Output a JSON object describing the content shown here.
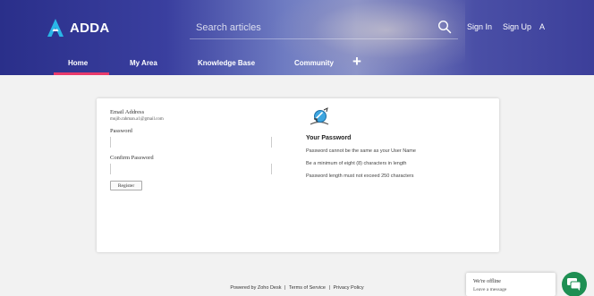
{
  "header": {
    "brand": "ADDA",
    "search_placeholder": "Search articles",
    "sign_in": "Sign In",
    "sign_up": "Sign Up",
    "lang": "A"
  },
  "nav": {
    "items": [
      {
        "label": "Home",
        "active": true
      },
      {
        "label": "My Area"
      },
      {
        "label": "Knowledge Base"
      },
      {
        "label": "Community"
      }
    ],
    "plus": "+",
    "accent_color": "#e83a6b"
  },
  "form": {
    "email_label": "Email Address",
    "email_value": "mujib.rahman.a1@gmail.com",
    "password_label": "Password",
    "confirm_label": "Confirm Password",
    "register_label": "Register"
  },
  "info": {
    "title": "Your Password",
    "rules": [
      "Password cannot be the same as your User Name",
      "Be a minimum of eight (8) characters in length",
      "Password length must not exceed 250 characters"
    ]
  },
  "footer": {
    "powered": "Powered by Zoho Desk",
    "sep1": "|",
    "terms": "Terms of Service",
    "sep2": "|",
    "privacy": "Privacy Policy"
  },
  "chat": {
    "offline": "We're offline",
    "leave": "Leave a message",
    "button_color": "#1e8f53"
  }
}
